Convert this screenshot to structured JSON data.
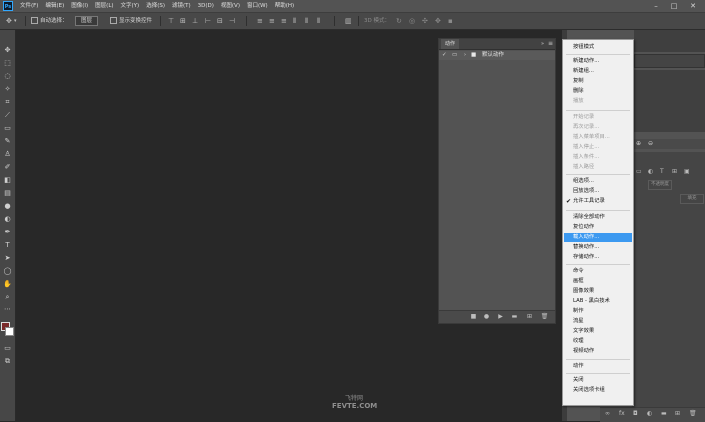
{
  "app": {
    "logo": "Ps"
  },
  "menubar": {
    "items": [
      "文件(F)",
      "编辑(E)",
      "图像(I)",
      "图层(L)",
      "文字(Y)",
      "选择(S)",
      "滤镜(T)",
      "3D(D)",
      "视图(V)",
      "窗口(W)",
      "帮助(H)"
    ]
  },
  "options": {
    "auto_select_label": "自动选择：",
    "auto_select_value": "图层",
    "show_transform_label": "显示变换控件",
    "mode_3d_label": "3D 模式："
  },
  "actions_panel": {
    "tab_label": "动作",
    "default_set_label": "默认动作"
  },
  "panel_menu": {
    "items": [
      {
        "label": "按钮模式",
        "enabled": true
      },
      {
        "label": "新建动作...",
        "enabled": true
      },
      {
        "label": "新建组...",
        "enabled": true
      },
      {
        "label": "复制",
        "enabled": true
      },
      {
        "label": "删除",
        "enabled": true
      },
      {
        "label": "播放",
        "enabled": false
      },
      {
        "label": "开始记录",
        "enabled": false
      },
      {
        "label": "再次记录...",
        "enabled": false
      },
      {
        "label": "插入菜单项目...",
        "enabled": false
      },
      {
        "label": "插入停止...",
        "enabled": false
      },
      {
        "label": "插入条件...",
        "enabled": false
      },
      {
        "label": "插入路径",
        "enabled": false
      },
      {
        "label": "组选项...",
        "enabled": true
      },
      {
        "label": "回放选项...",
        "enabled": true
      },
      {
        "label": "允许工具记录",
        "enabled": true,
        "checked": true
      },
      {
        "label": "清除全部动作",
        "enabled": true
      },
      {
        "label": "复位动作",
        "enabled": true
      },
      {
        "label": "载入动作...",
        "enabled": true,
        "highlighted": true
      },
      {
        "label": "替换动作...",
        "enabled": true
      },
      {
        "label": "存储动作...",
        "enabled": true
      },
      {
        "label": "命令",
        "enabled": true
      },
      {
        "label": "画框",
        "enabled": true
      },
      {
        "label": "图像效果",
        "enabled": true
      },
      {
        "label": "LAB - 黑白技术",
        "enabled": true
      },
      {
        "label": "制作",
        "enabled": true
      },
      {
        "label": "流星",
        "enabled": true
      },
      {
        "label": "文字效果",
        "enabled": true
      },
      {
        "label": "纹理",
        "enabled": true
      },
      {
        "label": "视频动作",
        "enabled": true
      },
      {
        "label": "动作",
        "enabled": true
      },
      {
        "label": "关闭",
        "enabled": true
      },
      {
        "label": "关闭选项卡组",
        "enabled": true
      }
    ]
  },
  "layers_panel": {
    "filter_label": "不透明度",
    "fill_label": "填充"
  },
  "watermark": {
    "line1": "飞特网",
    "line2": "FEVTE.COM"
  },
  "colors": {
    "highlight": "#3c99f0",
    "menu_bg": "#f0f0f0",
    "foreground_swatch": "#7a2a2a",
    "background_swatch": "#ffffff"
  }
}
